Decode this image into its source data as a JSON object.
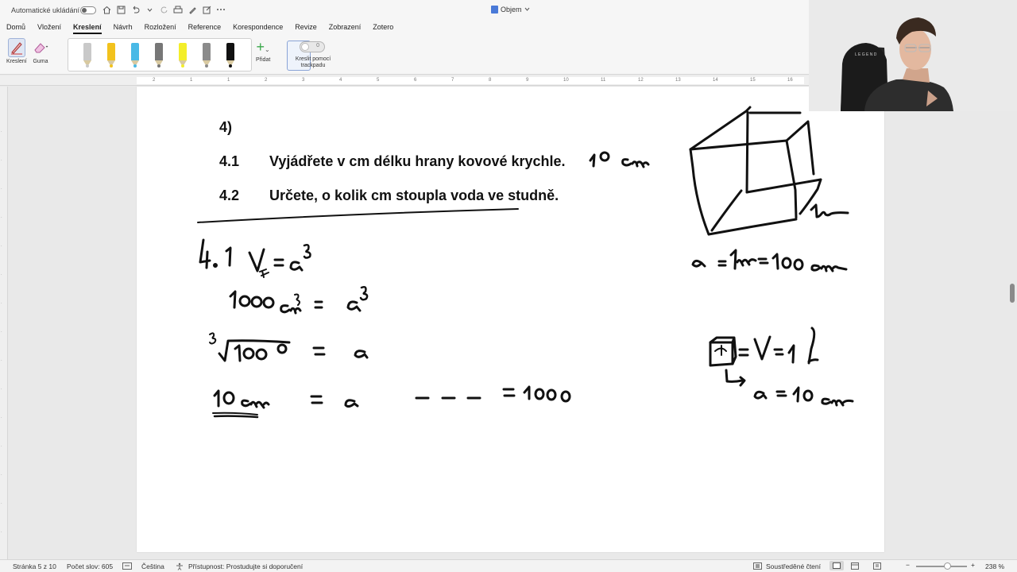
{
  "titlebar": {
    "autosave_label": "Automatické ukládání",
    "doc_title": "Objem"
  },
  "ribbon": {
    "tabs": [
      "Domů",
      "Vložení",
      "Kreslení",
      "Návrh",
      "Rozložení",
      "Reference",
      "Korespondence",
      "Revize",
      "Zobrazení",
      "Zotero"
    ],
    "active_tab": "Kreslení",
    "tools": {
      "draw_label": "Kreslení",
      "eraser_label": "Guma",
      "add_label": "Přidat",
      "trackpad_label_1": "Kreslit pomocí",
      "trackpad_label_2": "trackpadu",
      "trackpad_toggle_value": "0"
    },
    "pen_colors": [
      "#c9c9c9",
      "#f2c21d",
      "#49b9e6",
      "#777777",
      "#f3ee2a",
      "#8b8b8b",
      "#111111"
    ]
  },
  "ruler": {
    "ticks": [
      "2",
      "1",
      "1",
      "2",
      "3",
      "4",
      "5",
      "6",
      "7",
      "8",
      "9",
      "10",
      "11",
      "12",
      "13",
      "14",
      "15",
      "16"
    ]
  },
  "document": {
    "heading": "4)",
    "task_41_num": "4.1",
    "task_41_text": "Vyjádřete v cm délku hrany kovové krychle.",
    "task_42_num": "4.2",
    "task_42_text": "Určete, o kolik cm stoupla voda ve studně.",
    "ink_answer_41": "10cm"
  },
  "statusbar": {
    "page": "Stránka 5 z 10",
    "word_count": "Počet slov: 605",
    "language": "Čeština",
    "accessibility": "Přístupnost: Prostudujte si doporučení",
    "focus": "Soustředěné čtení",
    "zoom": "238 %"
  }
}
